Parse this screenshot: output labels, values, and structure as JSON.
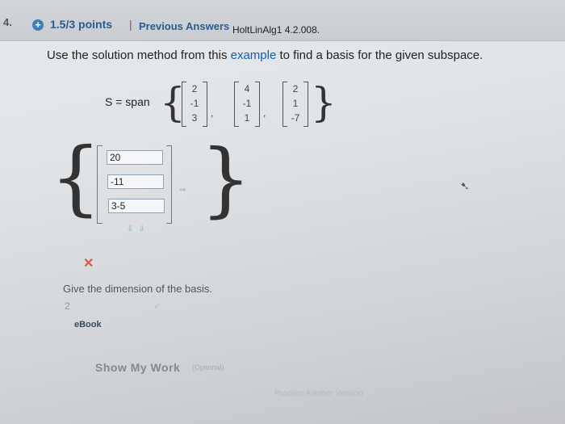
{
  "header": {
    "question_number": "4.",
    "points": "1.5/3 points",
    "separator": "|",
    "previous_answers": "Previous Answers",
    "question_code": "HoltLinAlg1 4.2.008."
  },
  "question": {
    "text_before": "Use the solution method from this ",
    "link": "example",
    "text_after": " to find a basis for the given subspace."
  },
  "subspace": {
    "label": "S = span",
    "vectors": [
      [
        "2",
        "-1",
        "3"
      ],
      [
        "4",
        "-1",
        "1"
      ],
      [
        "2",
        "1",
        "-7"
      ]
    ]
  },
  "answer_vector": {
    "values": [
      "20",
      "-11",
      "3-5"
    ],
    "arrow_right": "⇒",
    "arrow_down": "⇓⇓",
    "status": "✕"
  },
  "dimension": {
    "question": "Give the dimension of the basis.",
    "answer": "2",
    "status": "✓"
  },
  "links": {
    "ebook": "eBook",
    "show_my_work": "Show My Work",
    "optional": "(Optional)",
    "practice": "Practice Another Version"
  },
  "colors": {
    "accent": "#2b5c8f",
    "error": "#d9534f"
  },
  "icons": {
    "plus": "plus-icon",
    "cursor": "cursor-icon"
  }
}
